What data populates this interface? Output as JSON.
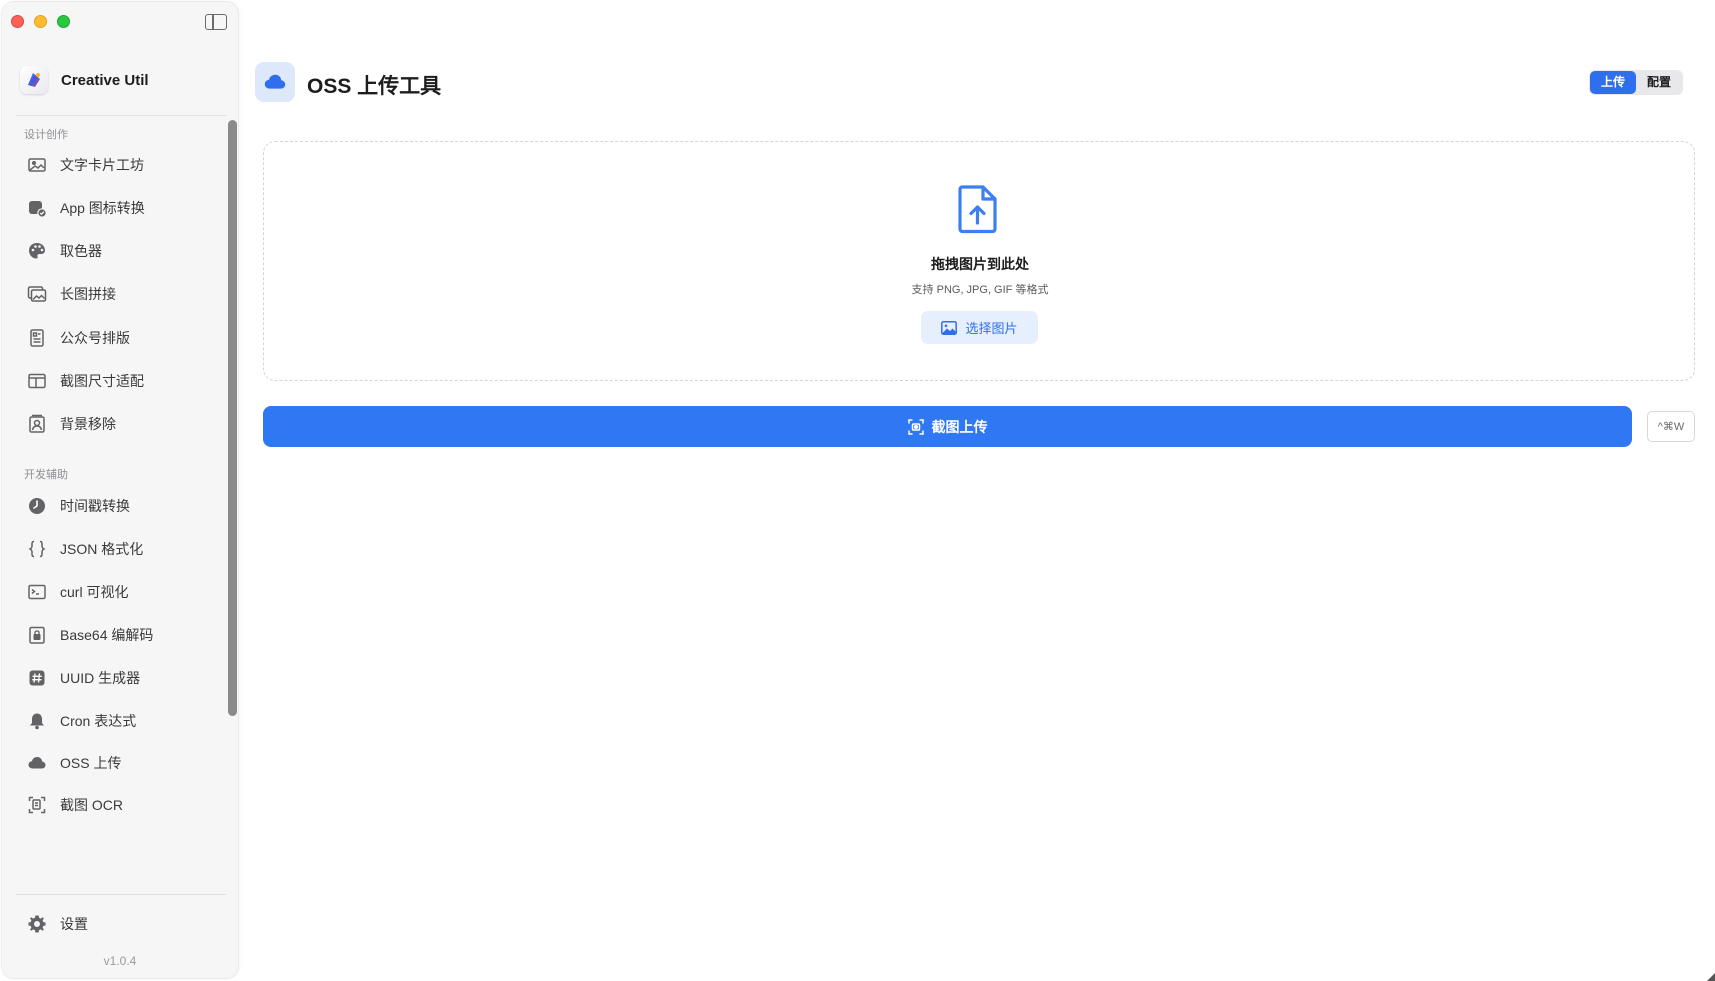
{
  "app": {
    "name": "Creative Util",
    "version": "v1.0.4"
  },
  "sidebar": {
    "sections": [
      {
        "label": "设计创作",
        "items": [
          {
            "label": "文字卡片工坊",
            "icon": "image-icon"
          },
          {
            "label": "App 图标转换",
            "icon": "app-icon-convert-icon"
          },
          {
            "label": "取色器",
            "icon": "palette-icon"
          },
          {
            "label": "长图拼接",
            "icon": "images-stack-icon"
          },
          {
            "label": "公众号排版",
            "icon": "document-layout-icon"
          },
          {
            "label": "截图尺寸适配",
            "icon": "layout-frame-icon"
          },
          {
            "label": "背景移除",
            "icon": "person-cutout-icon"
          }
        ]
      },
      {
        "label": "开发辅助",
        "items": [
          {
            "label": "时间戳转换",
            "icon": "clock-icon"
          },
          {
            "label": "JSON 格式化",
            "icon": "braces-icon"
          },
          {
            "label": "curl 可视化",
            "icon": "terminal-icon"
          },
          {
            "label": "Base64 编解码",
            "icon": "lock-icon"
          },
          {
            "label": "UUID 生成器",
            "icon": "hash-icon"
          },
          {
            "label": "Cron 表达式",
            "icon": "bell-icon"
          },
          {
            "label": "OSS 上传",
            "icon": "cloud-icon"
          },
          {
            "label": "截图 OCR",
            "icon": "scan-text-icon"
          }
        ]
      }
    ],
    "settings_label": "设置"
  },
  "header": {
    "title": "OSS 上传工具",
    "tabs": [
      {
        "label": "上传",
        "active": true
      },
      {
        "label": "配置",
        "active": false
      }
    ]
  },
  "dropzone": {
    "title": "拖拽图片到此处",
    "subtitle": "支持 PNG, JPG, GIF 等格式",
    "select_label": "选择图片"
  },
  "upload": {
    "label": "截图上传",
    "shortcut": "^⌘W"
  },
  "colors": {
    "accent": "#2f77f3",
    "accent_light": "#e6effd",
    "sidebar_bg": "#f6f6f6"
  }
}
